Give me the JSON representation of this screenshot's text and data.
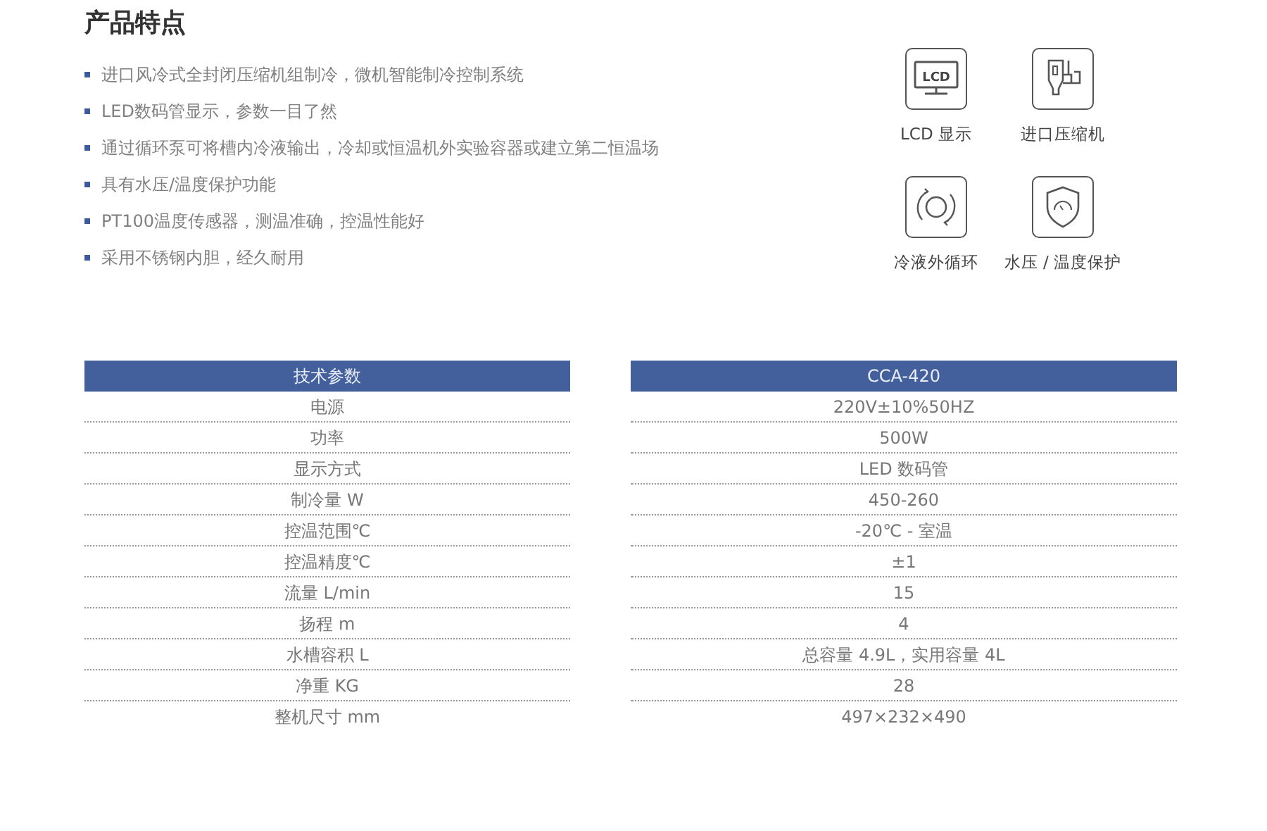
{
  "features": {
    "title": "产品特点",
    "bullets": [
      "进口风冷式全封闭压缩机组制冷，微机智能制冷控制系统",
      "LED数码管显示，参数一目了然",
      "通过循环泵可将槽内冷液输出，冷却或恒温机外实验容器或建立第二恒温场",
      "具有水压/温度保护功能",
      "PT100温度传感器，测温准确，控温性能好",
      "采用不锈钢内胆，经久耐用"
    ],
    "icons": [
      {
        "kind": "display",
        "icon_text": "LCD",
        "label": "LCD 显示"
      },
      {
        "kind": "compressor",
        "label": "进口压缩机"
      },
      {
        "kind": "circulation",
        "label": "冷液外循环"
      },
      {
        "kind": "shield",
        "label": "水压 / 温度保护"
      }
    ]
  },
  "spec_table": {
    "columns": [
      "技术参数",
      "CCA-420"
    ],
    "rows": [
      [
        "电源",
        "220V±10%50HZ"
      ],
      [
        "功率",
        "500W"
      ],
      [
        "显示方式",
        "LED 数码管"
      ],
      [
        "制冷量 W",
        "450-260"
      ],
      [
        "控温范围℃",
        "-20℃ - 室温"
      ],
      [
        "控温精度℃",
        "±1"
      ],
      [
        "流量 L/min",
        "15"
      ],
      [
        "扬程 m",
        "4"
      ],
      [
        "水槽容积 L",
        "总容量 4.9L，实用容量 4L"
      ],
      [
        "净重 KG",
        "28"
      ],
      [
        "整机尺寸 mm",
        "497×232×490"
      ]
    ]
  }
}
